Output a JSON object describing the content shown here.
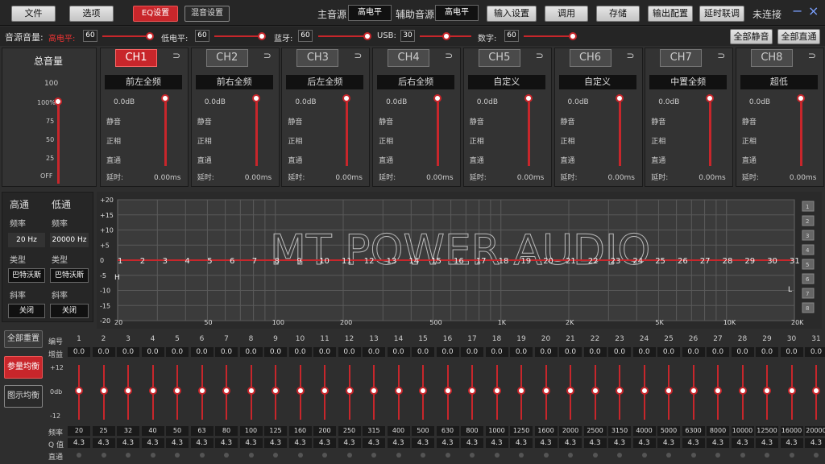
{
  "menu": {
    "file": "文件",
    "options": "选项",
    "eq_settings": "EQ设置",
    "mix_settings": "混音设置"
  },
  "source": {
    "main_label": "主音源",
    "main_value": "高电平",
    "aux_label": "辅助音源",
    "aux_value": "高电平"
  },
  "toolbar": {
    "input_settings": "输入设置",
    "recall": "调用",
    "save": "存储",
    "output_config": "输出配置",
    "delay_link": "延时联调",
    "status": "未连接",
    "minimize": "−",
    "close": "×"
  },
  "source_volume": {
    "label": "音源音量:",
    "high_label": "高电平:",
    "high_value": "60",
    "low_label": "低电平:",
    "low_value": "60",
    "bt_label": "蓝牙:",
    "bt_value": "60",
    "usb_label": "USB:",
    "usb_value": "30",
    "digital_label": "数字:",
    "digital_value": "60",
    "mute_all": "全部静音",
    "direct_all": "全部直通"
  },
  "master": {
    "title": "总音量",
    "max": "100",
    "levels": [
      "100%",
      "75",
      "50",
      "25",
      "OFF"
    ]
  },
  "channels": [
    {
      "id": "CH1",
      "name": "前左全频",
      "gain": "0.0dB",
      "mute": "静音",
      "phase": "正相",
      "direct": "直通",
      "delay_label": "延时:",
      "delay": "0.00ms",
      "active": true
    },
    {
      "id": "CH2",
      "name": "前右全频",
      "gain": "0.0dB",
      "mute": "静音",
      "phase": "正相",
      "direct": "直通",
      "delay_label": "延时:",
      "delay": "0.00ms",
      "active": false
    },
    {
      "id": "CH3",
      "name": "后左全频",
      "gain": "0.0dB",
      "mute": "静音",
      "phase": "正相",
      "direct": "直通",
      "delay_label": "延时:",
      "delay": "0.00ms",
      "active": false
    },
    {
      "id": "CH4",
      "name": "后右全频",
      "gain": "0.0dB",
      "mute": "静音",
      "phase": "正相",
      "direct": "直通",
      "delay_label": "延时:",
      "delay": "0.00ms",
      "active": false
    },
    {
      "id": "CH5",
      "name": "自定义",
      "gain": "0.0dB",
      "mute": "静音",
      "phase": "正相",
      "direct": "直通",
      "delay_label": "延时:",
      "delay": "0.00ms",
      "active": false
    },
    {
      "id": "CH6",
      "name": "自定义",
      "gain": "0.0dB",
      "mute": "静音",
      "phase": "正相",
      "direct": "直通",
      "delay_label": "延时:",
      "delay": "0.00ms",
      "active": false
    },
    {
      "id": "CH7",
      "name": "中置全频",
      "gain": "0.0dB",
      "mute": "静音",
      "phase": "正相",
      "direct": "直通",
      "delay_label": "延时:",
      "delay": "0.00ms",
      "active": false
    },
    {
      "id": "CH8",
      "name": "超低",
      "gain": "0.0dB",
      "mute": "静音",
      "phase": "正相",
      "direct": "直通",
      "delay_label": "延时:",
      "delay": "0.00ms",
      "active": false
    }
  ],
  "crossover": {
    "hp_label": "高通",
    "lp_label": "低通",
    "freq_label": "频率",
    "hp_freq": "20 Hz",
    "lp_freq": "20000 Hz",
    "type_label": "类型",
    "hp_type": "巴特沃斯",
    "lp_type": "巴特沃斯",
    "slope_label": "斜率",
    "hp_slope": "关闭",
    "lp_slope": "关闭"
  },
  "graph": {
    "watermark": "MT POWER AUDIO",
    "ylabels": [
      "+20",
      "+15",
      "+10",
      "+5",
      "0",
      "-5",
      "-10",
      "-15",
      "-20"
    ],
    "xlabels": [
      "20",
      "50",
      "100",
      "200",
      "500",
      "1K",
      "2K",
      "5K",
      "10K",
      "20K"
    ],
    "h_marker": "H",
    "l_marker": "L",
    "points": [
      "1",
      "2",
      "3",
      "4",
      "5",
      "6",
      "7",
      "8",
      "9",
      "10",
      "11",
      "12",
      "13",
      "14",
      "15",
      "16",
      "17",
      "18",
      "19",
      "20",
      "21",
      "22",
      "23",
      "24",
      "25",
      "26",
      "27",
      "28",
      "29",
      "30",
      "31"
    ],
    "side_buttons": [
      "1",
      "2",
      "3",
      "4",
      "5",
      "6",
      "7",
      "8"
    ]
  },
  "eq": {
    "reset_all": "全部重置",
    "param_eq": "参量均衡",
    "graphic_eq": "图示均衡",
    "num_label": "编号",
    "gain_label": "增益",
    "scale_top": "+12",
    "scale_mid": "0db",
    "scale_bot": "-12",
    "freq_label": "频率",
    "q_label": "Q 值",
    "direct_label": "直通",
    "bands": [
      {
        "n": "1",
        "g": "0.0",
        "f": "20",
        "q": "4.3"
      },
      {
        "n": "2",
        "g": "0.0",
        "f": "25",
        "q": "4.3"
      },
      {
        "n": "3",
        "g": "0.0",
        "f": "32",
        "q": "4.3"
      },
      {
        "n": "4",
        "g": "0.0",
        "f": "40",
        "q": "4.3"
      },
      {
        "n": "5",
        "g": "0.0",
        "f": "50",
        "q": "4.3"
      },
      {
        "n": "6",
        "g": "0.0",
        "f": "63",
        "q": "4.3"
      },
      {
        "n": "7",
        "g": "0.0",
        "f": "80",
        "q": "4.3"
      },
      {
        "n": "8",
        "g": "0.0",
        "f": "100",
        "q": "4.3"
      },
      {
        "n": "9",
        "g": "0.0",
        "f": "125",
        "q": "4.3"
      },
      {
        "n": "10",
        "g": "0.0",
        "f": "160",
        "q": "4.3"
      },
      {
        "n": "11",
        "g": "0.0",
        "f": "200",
        "q": "4.3"
      },
      {
        "n": "12",
        "g": "0.0",
        "f": "250",
        "q": "4.3"
      },
      {
        "n": "13",
        "g": "0.0",
        "f": "315",
        "q": "4.3"
      },
      {
        "n": "14",
        "g": "0.0",
        "f": "400",
        "q": "4.3"
      },
      {
        "n": "15",
        "g": "0.0",
        "f": "500",
        "q": "4.3"
      },
      {
        "n": "16",
        "g": "0.0",
        "f": "630",
        "q": "4.3"
      },
      {
        "n": "17",
        "g": "0.0",
        "f": "800",
        "q": "4.3"
      },
      {
        "n": "18",
        "g": "0.0",
        "f": "1000",
        "q": "4.3"
      },
      {
        "n": "19",
        "g": "0.0",
        "f": "1250",
        "q": "4.3"
      },
      {
        "n": "20",
        "g": "0.0",
        "f": "1600",
        "q": "4.3"
      },
      {
        "n": "21",
        "g": "0.0",
        "f": "2000",
        "q": "4.3"
      },
      {
        "n": "22",
        "g": "0.0",
        "f": "2500",
        "q": "4.3"
      },
      {
        "n": "23",
        "g": "0.0",
        "f": "3150",
        "q": "4.3"
      },
      {
        "n": "24",
        "g": "0.0",
        "f": "4000",
        "q": "4.3"
      },
      {
        "n": "25",
        "g": "0.0",
        "f": "5000",
        "q": "4.3"
      },
      {
        "n": "26",
        "g": "0.0",
        "f": "6300",
        "q": "4.3"
      },
      {
        "n": "27",
        "g": "0.0",
        "f": "8000",
        "q": "4.3"
      },
      {
        "n": "28",
        "g": "0.0",
        "f": "10000",
        "q": "4.3"
      },
      {
        "n": "29",
        "g": "0.0",
        "f": "12500",
        "q": "4.3"
      },
      {
        "n": "30",
        "g": "0.0",
        "f": "16000",
        "q": "4.3"
      },
      {
        "n": "31",
        "g": "0.0",
        "f": "20000",
        "q": "4.3"
      }
    ]
  }
}
